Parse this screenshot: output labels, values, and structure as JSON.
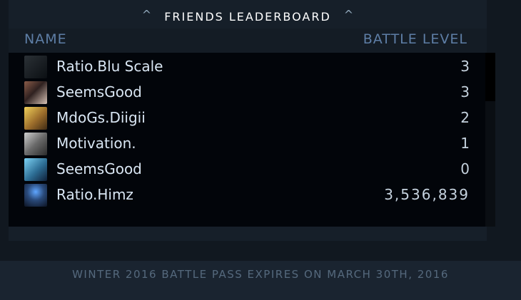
{
  "leaderboard": {
    "title": "FRIENDS LEADERBOARD",
    "columns": {
      "name": "NAME",
      "level": "BATTLE LEVEL"
    },
    "rows": [
      {
        "name": "Ratio.Blu Scale",
        "level": "3"
      },
      {
        "name": "SeemsGood",
        "level": "3"
      },
      {
        "name": "MdoGs.Diigii",
        "level": "2"
      },
      {
        "name": "Motivation.",
        "level": "1"
      },
      {
        "name": "SeemsGood",
        "level": "0"
      },
      {
        "name": "Ratio.Himz",
        "level": "3,536,839"
      }
    ]
  },
  "footer": {
    "expiry": "WINTER 2016 BATTLE PASS EXPIRES ON MARCH 30TH, 2016"
  },
  "icons": {
    "collapse_left": "chevron-up-icon",
    "collapse_right": "chevron-up-icon"
  }
}
